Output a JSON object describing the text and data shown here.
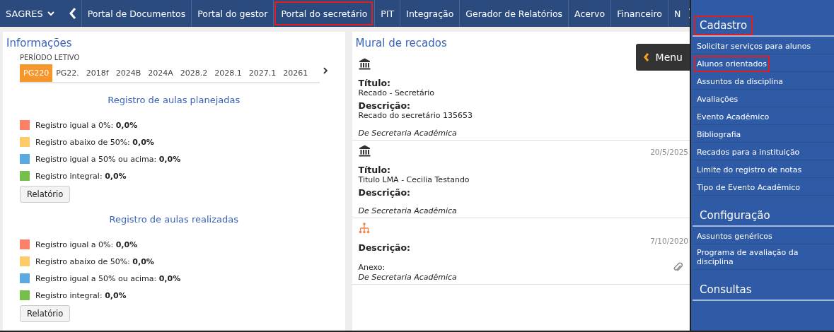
{
  "top_nav": {
    "brand": "SAGRES",
    "items": [
      {
        "label": "Portal de Documentos",
        "highlighted": false
      },
      {
        "label": "Portal do gestor",
        "highlighted": false
      },
      {
        "label": "Portal do secretário",
        "highlighted": true
      },
      {
        "label": "PIT",
        "highlighted": false
      },
      {
        "label": "Integração",
        "highlighted": false
      },
      {
        "label": "Gerador de Relatórios",
        "highlighted": false
      },
      {
        "label": "Acervo",
        "highlighted": false
      },
      {
        "label": "Financeiro",
        "highlighted": false
      },
      {
        "label": "N",
        "highlighted": false
      }
    ]
  },
  "info_panel": {
    "title": "Informações",
    "period_label": "PERÍODO LETIVO",
    "periods": [
      {
        "label": "PG220",
        "selected": true
      },
      {
        "label": "PG22.",
        "selected": false
      },
      {
        "label": "2018f",
        "selected": false
      },
      {
        "label": "2024B",
        "selected": false
      },
      {
        "label": "2024A",
        "selected": false
      },
      {
        "label": "2028.2",
        "selected": false
      },
      {
        "label": "2028.1",
        "selected": false
      },
      {
        "label": "2027.1",
        "selected": false
      },
      {
        "label": "20261",
        "selected": false
      }
    ],
    "sections": [
      {
        "title": "Registro de aulas planejadas",
        "legend": [
          {
            "label": "Registro igual a 0%:",
            "value": "0,0%",
            "color": "#fd8068"
          },
          {
            "label": "Registro abaixo de 50%:",
            "value": "0,0%",
            "color": "#fecb6a"
          },
          {
            "label": "Registro igual a 50% ou acima:",
            "value": "0,0%",
            "color": "#5aa9e0"
          },
          {
            "label": "Registro integral:",
            "value": "0,0%",
            "color": "#76bf4b"
          }
        ],
        "button": "Relatório"
      },
      {
        "title": "Registro de aulas realizadas",
        "legend": [
          {
            "label": "Registro igual a 0%:",
            "value": "0,0%",
            "color": "#fd8068"
          },
          {
            "label": "Registro abaixo de 50%:",
            "value": "0,0%",
            "color": "#fecb6a"
          },
          {
            "label": "Registro igual a 50% ou acima:",
            "value": "0,0%",
            "color": "#5aa9e0"
          },
          {
            "label": "Registro integral:",
            "value": "0,0%",
            "color": "#76bf4b"
          }
        ],
        "button": "Relatório"
      }
    ]
  },
  "mural": {
    "title": "Mural de recados",
    "menu_button": "Menu",
    "messages": [
      {
        "kind": "bank",
        "title_label": "Título:",
        "title": "Recado - Secretário",
        "description_label": "Descrição:",
        "description": "Recado do secretário 135653",
        "author": "De Secretaria Acadêmica"
      },
      {
        "kind": "bank",
        "date": "20/5/2025",
        "title_label": "Título:",
        "title": "Titulo LMA - Cecilia Testando",
        "description_label": "Descrição:",
        "author": "De Secretaria Acadêmica"
      },
      {
        "kind": "hierarchy",
        "date": "7/10/2020",
        "description_label": "Descrição:",
        "attachment_label": "Anexo:",
        "author": "De Secretaria Acadêmica"
      }
    ]
  },
  "sidebar": {
    "sections": [
      {
        "heading": "Cadastro",
        "highlighted": true,
        "items": [
          {
            "label": "Solicitar serviços para alunos",
            "highlighted": false
          },
          {
            "label": "Alunos orientados",
            "highlighted": true
          },
          {
            "label": "Assuntos da disciplina",
            "highlighted": false
          },
          {
            "label": "Avaliações",
            "highlighted": false
          },
          {
            "label": "Evento Acadêmico",
            "highlighted": false
          },
          {
            "label": "Bibliografia",
            "highlighted": false
          },
          {
            "label": "Recados para a instituição",
            "highlighted": false
          },
          {
            "label": "Limite do registro de notas",
            "highlighted": false
          },
          {
            "label": "Tipo de Evento Acadêmico",
            "highlighted": false
          }
        ]
      },
      {
        "heading": "Configuração",
        "highlighted": false,
        "items": [
          {
            "label": "Assuntos genéricos",
            "highlighted": false
          },
          {
            "label": "Programa de avaliação da disciplina",
            "highlighted": false
          }
        ]
      },
      {
        "heading": "Consultas",
        "highlighted": false
      }
    ]
  }
}
